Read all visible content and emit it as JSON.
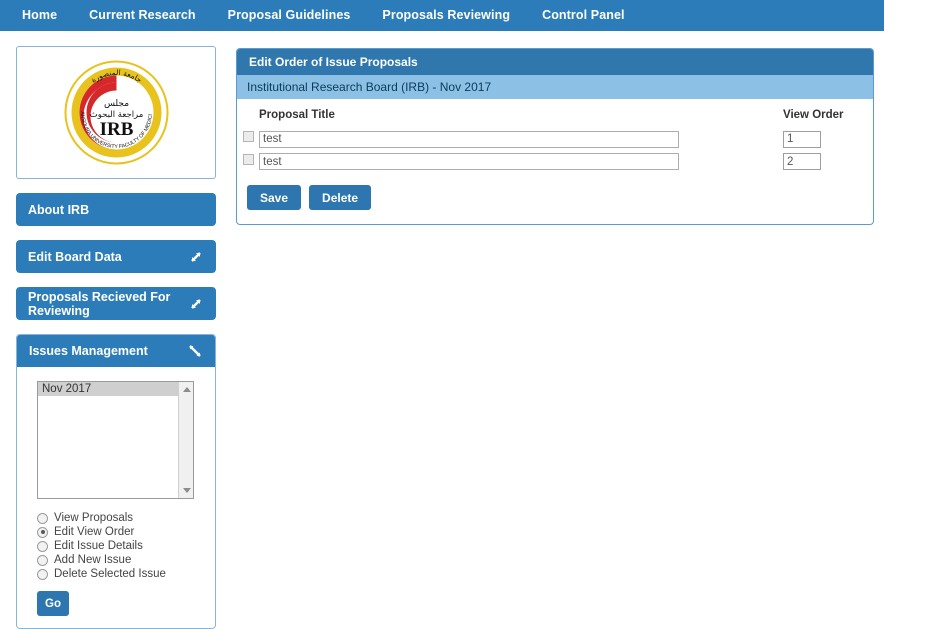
{
  "navbar": {
    "items": [
      {
        "label": "Home",
        "name": "nav-home"
      },
      {
        "label": "Current Research",
        "name": "nav-current-research"
      },
      {
        "label": "Proposal Guidelines",
        "name": "nav-proposal-guidelines"
      },
      {
        "label": "Proposals Reviewing",
        "name": "nav-proposals-reviewing"
      },
      {
        "label": "Control Panel",
        "name": "nav-control-panel"
      }
    ]
  },
  "sidebar": {
    "logo": {
      "acronym": "IRB",
      "arabic_line1": "مجلس",
      "arabic_line2": "مراجعة البحوث",
      "ring_top_text": "جامعة المنصورة",
      "ring_bottom_text": "MANSOURA UNIVERSITY FACULTY OF MEDICINE"
    },
    "buttons": [
      {
        "label": "About IRB",
        "has_arrows": false,
        "arrows": ""
      },
      {
        "label": "Edit Board Data",
        "has_arrows": true,
        "arrows": "expand"
      },
      {
        "label": "Proposals Recieved For Reviewing",
        "has_arrows": true,
        "arrows": "expand"
      }
    ],
    "issues_panel": {
      "title": "Issues Management",
      "arrows": "collapse",
      "listbox": {
        "options": [
          "Nov 2017"
        ],
        "selected": "Nov 2017"
      },
      "radios": [
        {
          "label": "View Proposals",
          "selected": false
        },
        {
          "label": "Edit View Order",
          "selected": true
        },
        {
          "label": "Edit Issue Details",
          "selected": false
        },
        {
          "label": "Add New Issue",
          "selected": false
        },
        {
          "label": "Delete Selected Issue",
          "selected": false
        }
      ],
      "go_label": "Go"
    }
  },
  "main": {
    "panel_title": "Edit Order of Issue Proposals",
    "panel_subtitle": "Institutional Research Board (IRB) - Nov 2017",
    "table": {
      "headers": {
        "checkbox": "",
        "title": "Proposal Title",
        "order": "View Order"
      },
      "rows": [
        {
          "checked": false,
          "title": "test",
          "order": "1"
        },
        {
          "checked": false,
          "title": "test",
          "order": "2"
        }
      ]
    },
    "buttons": {
      "save": "Save",
      "delete": "Delete"
    }
  },
  "colors": {
    "navbar": "#2b7cb8",
    "panel_header": "#2f77ad",
    "panel_subheader": "#8cc0e4",
    "button": "#2e76b0",
    "logo_red": "#d6272a",
    "logo_gold": "#e8c31e"
  }
}
